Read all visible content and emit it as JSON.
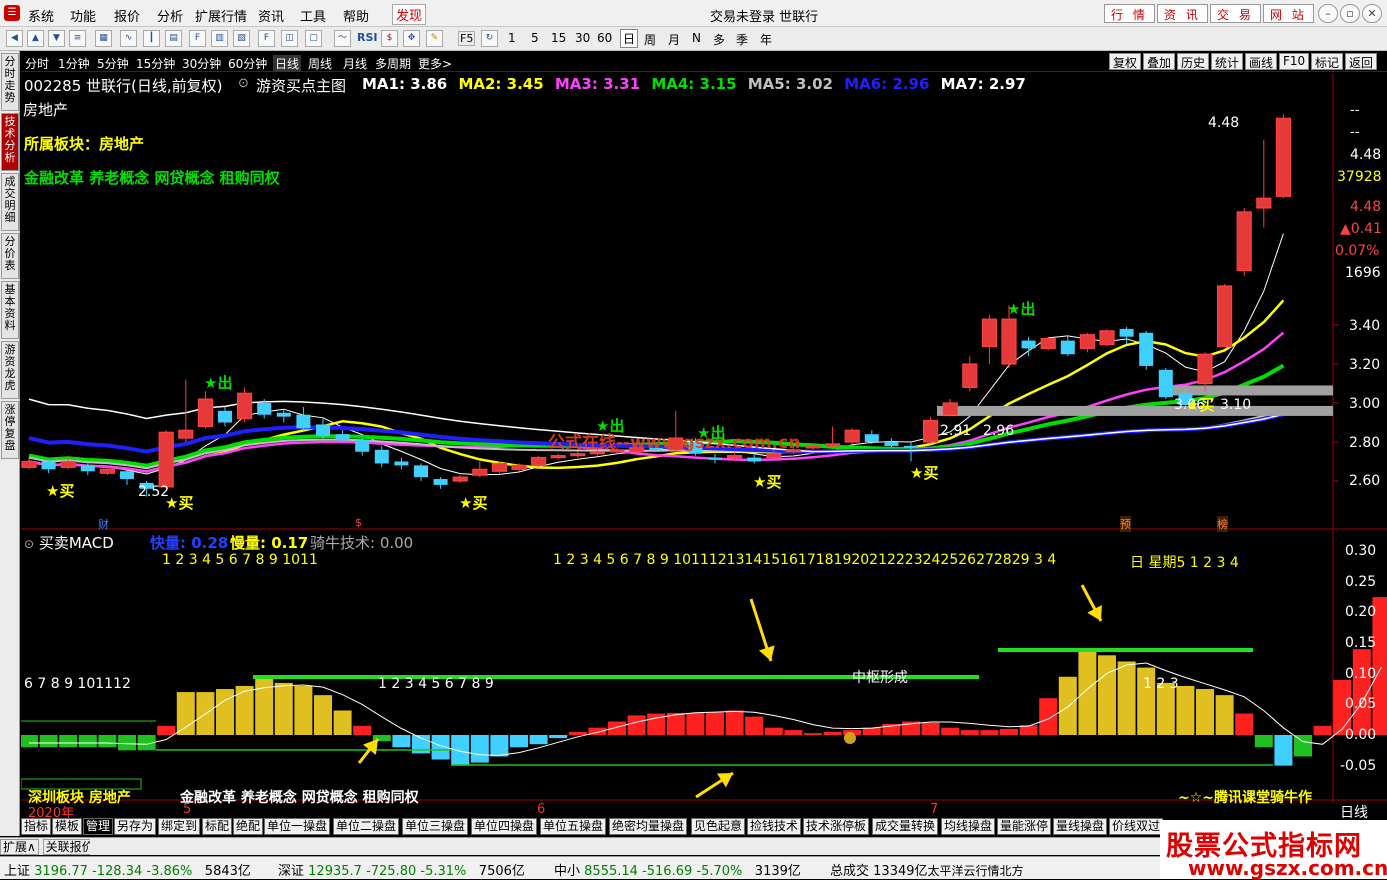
{
  "menu": {
    "items": [
      "系统",
      "功能",
      "报价",
      "分析",
      "扩展行情",
      "资讯",
      "工具",
      "帮助",
      "发现"
    ],
    "window_title": "交易未登录 世联行",
    "quick_buttons": [
      "行 情",
      "资 讯",
      "交 易",
      "网 站"
    ]
  },
  "toolbar": {
    "periods": [
      "1",
      "5",
      "15",
      "30",
      "60",
      "日",
      "周",
      "月",
      "N",
      "多",
      "季",
      "年"
    ],
    "icon_labels": [
      "RSI",
      "F5"
    ]
  },
  "sidebar": {
    "tabs": [
      "分时走势",
      "技术分析",
      "成交明细",
      "分价表",
      "基本资料",
      "游资龙虎",
      "涨停复盘"
    ],
    "active": "技术分析"
  },
  "period_bar": {
    "items": [
      "分时",
      "1分钟",
      "5分钟",
      "15分钟",
      "30分钟",
      "60分钟",
      "日线",
      "周线",
      "月线",
      "多周期",
      "更多>"
    ],
    "active": "日线",
    "right_buttons": [
      "复权",
      "叠加",
      "历史",
      "统计",
      "画线",
      "F10",
      "标记",
      "返回"
    ]
  },
  "main_chart": {
    "header": "002285 世联行(日线,前复权)",
    "indicator": "游资买点主图",
    "ma": [
      {
        "label": "MA1: 3.86",
        "color": "#ffffff"
      },
      {
        "label": "MA2: 3.45",
        "color": "#ffff00"
      },
      {
        "label": "MA3: 3.31",
        "color": "#ff40ff"
      },
      {
        "label": "MA4: 3.15",
        "color": "#00e000"
      },
      {
        "label": "MA5: 3.02",
        "color": "#c0c0c0"
      },
      {
        "label": "MA6: 2.96",
        "color": "#2020ff"
      },
      {
        "label": "MA7: 2.97",
        "color": "#ffffff"
      }
    ],
    "industry": "房地产",
    "board_line": "所属板块：房地产",
    "concepts": "金融改革 养老概念 网贷概念 租购同权",
    "watermark": "公式在线--www.gszx.com.cn",
    "price_labels": {
      "low1": "2.52",
      "top": "4.48",
      "p291": "2.91",
      "p296": "2.96",
      "p306": "3.06",
      "p310": "3.10"
    },
    "buy_label": "买",
    "sell_label": "出",
    "yaxis": [
      "3.40",
      "3.20",
      "3.00",
      "2.80",
      "2.60"
    ],
    "side_values": [
      "--",
      "--",
      "4.48",
      "37928",
      "4.48",
      "▲0.41",
      "0.07%",
      "1696"
    ],
    "markers": [
      "财",
      "$",
      "预",
      "榜"
    ]
  },
  "macd_panel": {
    "title": "买卖MACD",
    "fast": "快量: 0.28",
    "slow": "慢量: 0.17",
    "rider": "骑牛技术: 0.00",
    "count_row1_left": "1 2 3 4 5 6 7 8 9 1011",
    "count_row1_right": "1 2 3 4 5 6 7 8 9 1011121314151617181920212223242526272829 3 4",
    "weekday": "日 星期5 1 2 3 4",
    "count_left2": "6 7 8 9 101112",
    "count_mid": "1 2 3 4 5 6 7 8 9",
    "count_right": "1 2 3",
    "center_label": "中枢形成",
    "board_left": "深圳板块 房地产",
    "concept_bottom": "金融改革 养老概念 网贷概念 租购同权",
    "signature": "~☆~腾讯课堂骑牛作",
    "yaxis": [
      "0.30",
      "0.25",
      "0.20",
      "0.15",
      "0.10",
      "0.05",
      "0.00",
      "-0.05"
    ]
  },
  "time_axis": {
    "labels": [
      "2020年",
      "5",
      "6",
      "7"
    ],
    "corner": "日线"
  },
  "bottom_tabs": [
    "指标",
    "模板",
    "管理",
    "另存为",
    "绑定到",
    "标配",
    "绝配",
    "单位一操盘",
    "单位二操盘",
    "单位三操盘",
    "单位四操盘",
    "单位五操盘",
    "绝密均量操盘",
    "见色起意",
    "捡钱技术",
    "技术涨停板",
    "成交量转换",
    "均线操盘",
    "量能涨停",
    "量线操盘",
    "价线双过"
  ],
  "status": {
    "expand": "扩展∧",
    "related": "关联报价",
    "sh": {
      "name": "上证",
      "value": "3196.77",
      "chg": "-128.34",
      "pct": "-3.86%",
      "amt": "5843亿"
    },
    "sz": {
      "name": "深证",
      "value": "12935.7",
      "chg": "-725.80",
      "pct": "-5.31%",
      "amt": "7506亿"
    },
    "zx": {
      "name": "中小",
      "value": "8555.14",
      "chg": "-516.69",
      "pct": "-5.70%",
      "amt": "3139亿"
    },
    "total_label": "总成交",
    "total": "13349亿",
    "tail": "太平洋云行情北方"
  },
  "logo": {
    "text": "股票公式指标网",
    "url": "www.gszx.com.cn"
  },
  "chart_data": {
    "type": "candlestick",
    "title": "002285 世联行(日线,前复权)",
    "ylim": [
      2.5,
      4.55
    ],
    "candles": [
      {
        "o": 2.67,
        "c": 2.7,
        "h": 2.72,
        "l": 2.66
      },
      {
        "o": 2.7,
        "c": 2.66,
        "h": 2.71,
        "l": 2.64
      },
      {
        "o": 2.67,
        "c": 2.7,
        "h": 2.72,
        "l": 2.66
      },
      {
        "o": 2.68,
        "c": 2.65,
        "h": 2.69,
        "l": 2.63
      },
      {
        "o": 2.64,
        "c": 2.66,
        "h": 2.67,
        "l": 2.63
      },
      {
        "o": 2.65,
        "c": 2.61,
        "h": 2.66,
        "l": 2.58
      },
      {
        "o": 2.59,
        "c": 2.56,
        "h": 2.6,
        "l": 2.52
      },
      {
        "o": 2.57,
        "c": 2.85,
        "h": 2.86,
        "l": 2.56
      },
      {
        "o": 2.82,
        "c": 2.86,
        "h": 3.12,
        "l": 2.8
      },
      {
        "o": 2.88,
        "c": 3.02,
        "h": 3.06,
        "l": 2.87
      },
      {
        "o": 2.96,
        "c": 2.9,
        "h": 2.98,
        "l": 2.88
      },
      {
        "o": 2.92,
        "c": 3.05,
        "h": 3.08,
        "l": 2.9
      },
      {
        "o": 3.0,
        "c": 2.94,
        "h": 3.02,
        "l": 2.92
      },
      {
        "o": 2.95,
        "c": 2.93,
        "h": 2.97,
        "l": 2.9
      },
      {
        "o": 2.94,
        "c": 2.87,
        "h": 2.98,
        "l": 2.85
      },
      {
        "o": 2.89,
        "c": 2.83,
        "h": 2.92,
        "l": 2.81
      },
      {
        "o": 2.84,
        "c": 2.81,
        "h": 2.86,
        "l": 2.8
      },
      {
        "o": 2.81,
        "c": 2.75,
        "h": 2.82,
        "l": 2.73
      },
      {
        "o": 2.76,
        "c": 2.69,
        "h": 2.78,
        "l": 2.67
      },
      {
        "o": 2.7,
        "c": 2.68,
        "h": 2.72,
        "l": 2.66
      },
      {
        "o": 2.68,
        "c": 2.62,
        "h": 2.69,
        "l": 2.6
      },
      {
        "o": 2.61,
        "c": 2.58,
        "h": 2.62,
        "l": 2.56
      },
      {
        "o": 2.6,
        "c": 2.62,
        "h": 2.63,
        "l": 2.59
      },
      {
        "o": 2.63,
        "c": 2.66,
        "h": 2.7,
        "l": 2.62
      },
      {
        "o": 2.65,
        "c": 2.69,
        "h": 2.7,
        "l": 2.64
      },
      {
        "o": 2.66,
        "c": 2.68,
        "h": 2.69,
        "l": 2.65
      },
      {
        "o": 2.68,
        "c": 2.72,
        "h": 2.73,
        "l": 2.67
      },
      {
        "o": 2.72,
        "c": 2.73,
        "h": 2.74,
        "l": 2.71
      },
      {
        "o": 2.73,
        "c": 2.74,
        "h": 2.75,
        "l": 2.72
      },
      {
        "o": 2.74,
        "c": 2.75,
        "h": 2.76,
        "l": 2.73
      },
      {
        "o": 2.75,
        "c": 2.76,
        "h": 2.77,
        "l": 2.74
      },
      {
        "o": 2.75,
        "c": 2.77,
        "h": 2.79,
        "l": 2.74
      },
      {
        "o": 2.77,
        "c": 2.76,
        "h": 2.78,
        "l": 2.75
      },
      {
        "o": 2.76,
        "c": 2.82,
        "h": 2.96,
        "l": 2.75
      },
      {
        "o": 2.8,
        "c": 2.74,
        "h": 2.82,
        "l": 2.73
      },
      {
        "o": 2.72,
        "c": 2.71,
        "h": 2.74,
        "l": 2.69
      },
      {
        "o": 2.72,
        "c": 2.73,
        "h": 2.75,
        "l": 2.7
      },
      {
        "o": 2.72,
        "c": 2.7,
        "h": 2.74,
        "l": 2.69
      },
      {
        "o": 2.72,
        "c": 2.74,
        "h": 2.76,
        "l": 2.71
      },
      {
        "o": 2.75,
        "c": 2.76,
        "h": 2.78,
        "l": 2.74
      },
      {
        "o": 2.77,
        "c": 2.78,
        "h": 2.79,
        "l": 2.76
      },
      {
        "o": 2.78,
        "c": 2.79,
        "h": 2.88,
        "l": 2.77
      },
      {
        "o": 2.8,
        "c": 2.86,
        "h": 2.87,
        "l": 2.79
      },
      {
        "o": 2.84,
        "c": 2.8,
        "h": 2.86,
        "l": 2.79
      },
      {
        "o": 2.8,
        "c": 2.78,
        "h": 2.82,
        "l": 2.77
      },
      {
        "o": 2.78,
        "c": 2.77,
        "h": 2.8,
        "l": 2.7
      },
      {
        "o": 2.8,
        "c": 2.91,
        "h": 2.93,
        "l": 2.79
      },
      {
        "o": 2.94,
        "c": 3.0,
        "h": 3.02,
        "l": 2.93
      },
      {
        "o": 3.08,
        "c": 3.2,
        "h": 3.24,
        "l": 3.06
      },
      {
        "o": 3.29,
        "c": 3.43,
        "h": 3.45,
        "l": 3.2
      },
      {
        "o": 3.2,
        "c": 3.43,
        "h": 3.5,
        "l": 3.18
      },
      {
        "o": 3.32,
        "c": 3.28,
        "h": 3.34,
        "l": 3.24
      },
      {
        "o": 3.28,
        "c": 3.33,
        "h": 3.34,
        "l": 3.27
      },
      {
        "o": 3.32,
        "c": 3.25,
        "h": 3.34,
        "l": 3.24
      },
      {
        "o": 3.28,
        "c": 3.35,
        "h": 3.36,
        "l": 3.26
      },
      {
        "o": 3.3,
        "c": 3.37,
        "h": 3.38,
        "l": 3.29
      },
      {
        "o": 3.38,
        "c": 3.34,
        "h": 3.39,
        "l": 3.3
      },
      {
        "o": 3.36,
        "c": 3.19,
        "h": 3.37,
        "l": 3.17
      },
      {
        "o": 3.17,
        "c": 3.03,
        "h": 3.18,
        "l": 3.02
      },
      {
        "o": 3.05,
        "c": 2.99,
        "h": 3.07,
        "l": 2.98
      },
      {
        "o": 3.1,
        "c": 3.25,
        "h": 3.26,
        "l": 3.06
      },
      {
        "o": 3.29,
        "c": 3.6,
        "h": 3.61,
        "l": 3.29
      },
      {
        "o": 3.68,
        "c": 3.98,
        "h": 4.0,
        "l": 3.65
      },
      {
        "o": 4.0,
        "c": 4.05,
        "h": 4.35,
        "l": 3.9
      },
      {
        "o": 4.06,
        "c": 4.46,
        "h": 4.48,
        "l": 4.05
      }
    ],
    "buy_points_index": [
      1,
      7,
      22,
      38,
      47,
      58
    ],
    "sell_points_index": [
      9,
      32,
      36,
      50
    ],
    "macd_hist": [
      -0.02,
      -0.02,
      -0.02,
      -0.02,
      -0.02,
      -0.025,
      -0.025,
      0.015,
      0.07,
      0.07,
      0.075,
      0.08,
      0.095,
      0.085,
      0.08,
      0.065,
      0.04,
      0.015,
      -0.01,
      -0.02,
      -0.03,
      -0.04,
      -0.05,
      -0.045,
      -0.035,
      -0.02,
      -0.015,
      -0.005,
      0.005,
      0.012,
      0.022,
      0.032,
      0.035,
      0.036,
      0.036,
      0.037,
      0.04,
      0.03,
      0.012,
      0.008,
      0.003,
      0.005,
      0.008,
      0.012,
      0.018,
      0.022,
      0.02,
      0.012,
      0.008,
      0.008,
      0.01,
      0.016,
      0.06,
      0.095,
      0.14,
      0.13,
      0.12,
      0.11,
      0.085,
      0.08,
      0.075,
      0.065,
      0.035,
      -0.02,
      -0.05,
      -0.035,
      0.015,
      0.09,
      0.14,
      0.225
    ],
    "macd_ylim": [
      -0.07,
      0.32
    ]
  }
}
